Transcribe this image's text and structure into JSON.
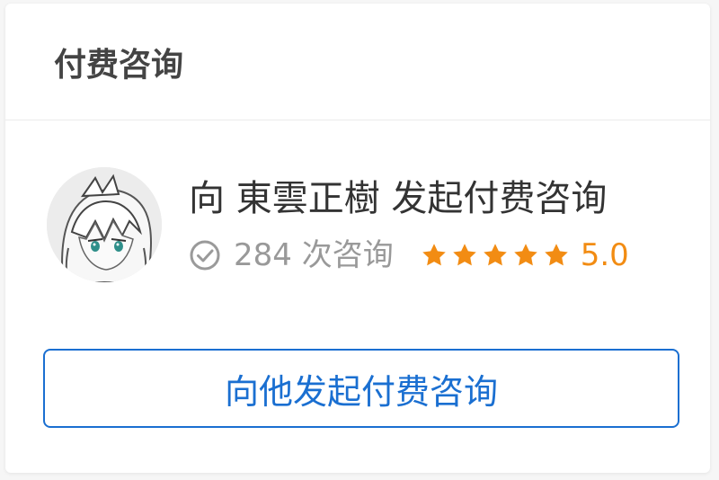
{
  "header": {
    "title": "付费咨询"
  },
  "profile": {
    "avatar": "anime-style avatar",
    "headline": "向 東雲正樹 发起付费咨询",
    "consult_count": "284 次咨询",
    "check_icon": "check-circle-icon",
    "stars": 5,
    "star_color": "#f28c13",
    "rating": "5.0"
  },
  "action": {
    "button_label": "向他发起付费咨询",
    "accent_color": "#1a6fd1"
  }
}
